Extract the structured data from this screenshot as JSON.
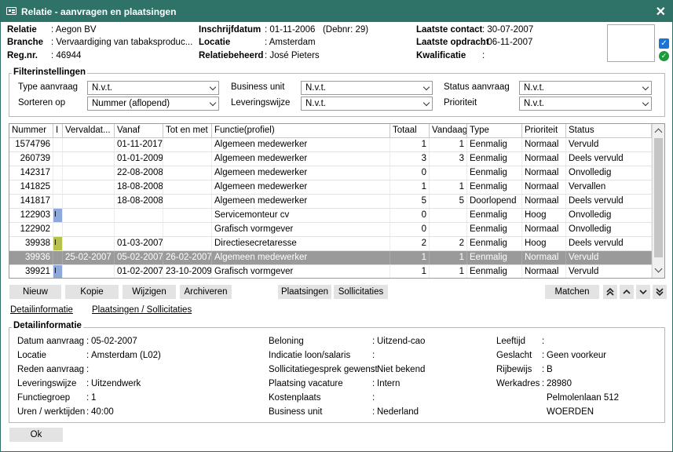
{
  "window": {
    "title": "Relatie - aanvragen en plaatsingen",
    "close": "✕"
  },
  "header": {
    "relatie_label": "Relatie",
    "relatie_value": "Aegon BV",
    "branche_label": "Branche",
    "branche_value": "Vervaardiging van tabaksproduc...",
    "regnr_label": "Reg.nr.",
    "regnr_value": "46944",
    "inschrijf_label": "Inschrijfdatum",
    "inschrijf_value": "01-11-2006   (Debnr: 29)",
    "locatie_label": "Locatie",
    "locatie_value": "Amsterdam",
    "beheerder_label": "Relatiebeheerder",
    "beheerder_value": "José Pieters",
    "contact_label": "Laatste contact",
    "contact_value": "30-07-2007",
    "opdracht_label": "Laatste opdracht",
    "opdracht_value": "06-11-2007",
    "kwal_label": "Kwalificatie",
    "kwal_value": ""
  },
  "filters": {
    "title": "Filterinstellingen",
    "type_label": "Type aanvraag",
    "type_value": "N.v.t.",
    "sort_label": "Sorteren op",
    "sort_value": "Nummer (aflopend)",
    "bu_label": "Business unit",
    "bu_value": "N.v.t.",
    "lev_label": "Leveringswijze",
    "lev_value": "N.v.t.",
    "status_label": "Status aanvraag",
    "status_value": "N.v.t.",
    "prio_label": "Prioriteit",
    "prio_value": "N.v.t."
  },
  "table": {
    "columns": [
      "Nummer",
      "I",
      "Vervaldat...",
      "Vanaf",
      "Tot en met",
      "Functie(profiel)",
      "Totaal",
      "Vandaag",
      "Type",
      "Prioriteit",
      "Status"
    ],
    "rows": [
      {
        "nummer": "1574796",
        "i": "",
        "verval": "",
        "vanaf": "01-11-2017",
        "tot": "",
        "functie": "Algemeen medewerker",
        "totaal": "1",
        "vandaag": "1",
        "type": "Eenmalig",
        "prio": "Normaal",
        "status": "Vervuld"
      },
      {
        "nummer": "260739",
        "i": "",
        "verval": "",
        "vanaf": "01-01-2009",
        "tot": "",
        "functie": "Algemeen medewerker",
        "totaal": "3",
        "vandaag": "3",
        "type": "Eenmalig",
        "prio": "Normaal",
        "status": "Deels vervuld"
      },
      {
        "nummer": "142317",
        "i": "",
        "verval": "",
        "vanaf": "22-08-2008",
        "tot": "",
        "functie": "Algemeen medewerker",
        "totaal": "0",
        "vandaag": "",
        "type": "Eenmalig",
        "prio": "Normaal",
        "status": "Onvolledig"
      },
      {
        "nummer": "141825",
        "i": "",
        "verval": "",
        "vanaf": "18-08-2008",
        "tot": "",
        "functie": "Algemeen medewerker",
        "totaal": "1",
        "vandaag": "1",
        "type": "Eenmalig",
        "prio": "Normaal",
        "status": "Vervallen"
      },
      {
        "nummer": "141817",
        "i": "",
        "verval": "",
        "vanaf": "18-08-2008",
        "tot": "",
        "functie": "Algemeen medewerker",
        "totaal": "5",
        "vandaag": "5",
        "type": "Doorlopend",
        "prio": "Normaal",
        "status": "Deels vervuld"
      },
      {
        "nummer": "122903",
        "i": "I",
        "verval": "",
        "vanaf": "",
        "tot": "",
        "functie": "Servicemonteur cv",
        "totaal": "0",
        "vandaag": "",
        "type": "Eenmalig",
        "prio": "Hoog",
        "status": "Onvolledig"
      },
      {
        "nummer": "122902",
        "i": "",
        "verval": "",
        "vanaf": "",
        "tot": "",
        "functie": "Grafisch vormgever",
        "totaal": "0",
        "vandaag": "",
        "type": "Eenmalig",
        "prio": "Normaal",
        "status": "Onvolledig"
      },
      {
        "nummer": "39938",
        "i": "I",
        "verval": "",
        "vanaf": "01-03-2007",
        "tot": "",
        "functie": "Directiesecretaresse",
        "totaal": "2",
        "vandaag": "2",
        "type": "Eenmalig",
        "prio": "Hoog",
        "status": "Deels vervuld"
      },
      {
        "nummer": "39936",
        "i": "",
        "verval": "25-02-2007",
        "vanaf": "05-02-2007",
        "tot": "26-02-2007",
        "functie": "Algemeen medewerker",
        "totaal": "1",
        "vandaag": "1",
        "type": "Eenmalig",
        "prio": "Normaal",
        "status": "Vervuld"
      },
      {
        "nummer": "39921",
        "i": "I",
        "verval": "",
        "vanaf": "01-02-2007",
        "tot": "23-10-2009",
        "functie": "Grafisch vormgever",
        "totaal": "1",
        "vandaag": "1",
        "type": "Eenmalig",
        "prio": "Normaal",
        "status": "Vervuld"
      }
    ],
    "selected_index": 8,
    "marker_colors": {
      "blue": "#8fa8dc",
      "olive": "#b7c24a"
    }
  },
  "buttons": {
    "nieuw": "Nieuw",
    "kopie": "Kopie",
    "wijzigen": "Wijzigen",
    "archiveren": "Archiveren",
    "plaatsingen": "Plaatsingen",
    "sollicitaties": "Sollicitaties",
    "matchen": "Matchen",
    "ok": "Ok"
  },
  "tabs": {
    "detail": "Detailinformatie",
    "plaatsingen": "Plaatsingen / Sollicitaties"
  },
  "detail": {
    "title": "Detailinformatie",
    "c1": [
      {
        "label": "Datum aanvraag",
        "value": "05-02-2007"
      },
      {
        "label": "Locatie",
        "value": "Amsterdam (L02)"
      },
      {
        "label": "Reden aanvraag",
        "value": ""
      },
      {
        "label": "Leveringswijze",
        "value": "Uitzendwerk"
      },
      {
        "label": "Functiegroep",
        "value": "1"
      },
      {
        "label": "Uren / werktijden",
        "value": "40:00"
      }
    ],
    "c2": [
      {
        "label": "Beloning",
        "value": "Uitzend-cao"
      },
      {
        "label": "Indicatie loon/salaris",
        "value": ""
      },
      {
        "label": "Sollicitatiegesprek gewenst",
        "value": "Niet bekend"
      },
      {
        "label": "Plaatsing vacature",
        "value": "Intern"
      },
      {
        "label": "Kostenplaats",
        "value": ""
      },
      {
        "label": "Business unit",
        "value": "Nederland"
      }
    ],
    "c3": [
      {
        "label": "Leeftijd",
        "value": ""
      },
      {
        "label": "Geslacht",
        "value": "Geen voorkeur"
      },
      {
        "label": "Rijbewijs",
        "value": "B"
      },
      {
        "label": "Werkadres",
        "value": "28980"
      },
      {
        "label": "",
        "value": "Pelmolenlaan 512"
      },
      {
        "label": "",
        "value": "WOERDEN"
      }
    ]
  },
  "colors": {
    "titlebar": "#2e7268",
    "selected_row": "#9a9a9a"
  }
}
